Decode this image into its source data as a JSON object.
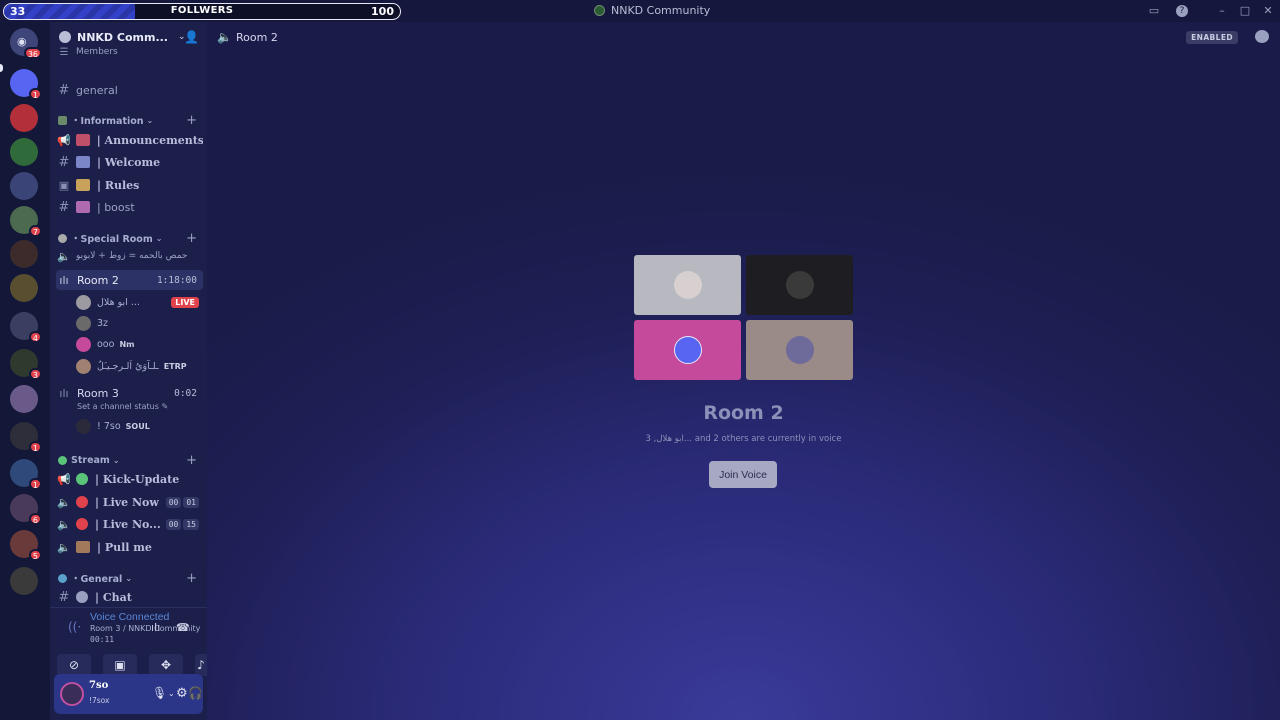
{
  "titlebar": {
    "followers_current": "33",
    "followers_label": "FOLLWERS",
    "followers_goal": "100",
    "followers_progress": 0.33,
    "app_title": "NNKD Community",
    "icons": [
      "inbox-icon",
      "help-icon",
      "minimize-icon",
      "maximize-icon",
      "close-icon"
    ]
  },
  "rail": {
    "home_badge": "36",
    "servers": [
      {
        "name": "discord-server",
        "badge": "1",
        "color": "#5865f2"
      },
      {
        "name": "red-server",
        "badge": "",
        "color": "#b3303a"
      },
      {
        "name": "nnkd-server",
        "badge": "",
        "color": "#2f6b3a"
      },
      {
        "name": "folder-server-1",
        "badge": "",
        "color": "#3b4476"
      },
      {
        "name": "folder-server-2",
        "badge": "7",
        "color": "#4c6a4f"
      },
      {
        "name": "dark-server",
        "badge": "",
        "color": "#3d2b2b"
      },
      {
        "name": "team-server",
        "badge": "",
        "color": "#5a4e30"
      },
      {
        "name": "folder-server-3",
        "badge": "4",
        "color": "#3a3f62"
      },
      {
        "name": "folder-server-4",
        "badge": "3",
        "color": "#2e3a2e"
      },
      {
        "name": "folder-server-5",
        "badge": "",
        "color": "#6a5a8a"
      },
      {
        "name": "folder-server-6",
        "badge": "1",
        "color": "#2e2e3a"
      },
      {
        "name": "folder-server-7",
        "badge": "1",
        "color": "#2f4a7a"
      },
      {
        "name": "folder-server-8",
        "badge": "6",
        "color": "#4a3a5a"
      },
      {
        "name": "folder-server-9",
        "badge": "5",
        "color": "#6a3a3a"
      },
      {
        "name": "folder-server-10",
        "badge": "",
        "color": "#3a3a3a"
      }
    ]
  },
  "sidebar": {
    "server_name": "NNKD Comm...",
    "members_label": "Members",
    "general": "general",
    "cat_information": "・Information",
    "announcements": "| Announcements",
    "welcome": "| Welcome",
    "rules": "| Rules",
    "boost": "| boost",
    "cat_special": "・Special Room",
    "arabic_room": "حمص بالحمه = زوط + لابوبو",
    "room2": "Room 2",
    "room2_timer": "1:18:00",
    "room2_users": [
      {
        "name": "ابو هلال ...",
        "tag": "",
        "live": "LIVE"
      },
      {
        "name": "3z",
        "tag": "",
        "live": ""
      },
      {
        "name": "ooo",
        "tag": "Nm",
        "live": ""
      },
      {
        "name": "ـلـآوَيُ اَلـرجـيـَلُ",
        "tag": "ETRP",
        "live": ""
      }
    ],
    "room3": "Room 3",
    "room3_timer": "0:02",
    "room3_status": "Set a channel status",
    "room3_users": [
      {
        "name": "! 7so",
        "tag": "SOUL"
      }
    ],
    "cat_stream": "Stream",
    "kick_update": "| Kick-Update",
    "live_now_1": "| Live Now",
    "live_now_1_nums": [
      "00",
      "01"
    ],
    "live_now_2": "| Live No...",
    "live_now_2_nums": [
      "00",
      "15"
    ],
    "pull_me": "| Pull me",
    "cat_general": "・General",
    "chat": "| Chat"
  },
  "voice": {
    "title": "Voice Connected",
    "sub": "Room 3 / NNKD Community",
    "time": "00:11"
  },
  "user": {
    "name": "7so",
    "sub": "!7sox"
  },
  "main": {
    "channel": "Room 2",
    "enabled_label": "ENABLED",
    "room_title": "Room 2",
    "room_sub": "ابو هلال, 3... and 2 others are currently in voice",
    "join_label": "Join Voice",
    "tiles": [
      {
        "name": "participant-tile-1",
        "bg": "#b8b8c0",
        "av": "#d8d0d0"
      },
      {
        "name": "participant-tile-2",
        "bg": "#1e1e22",
        "av": "#3a3a3a"
      },
      {
        "name": "participant-tile-3",
        "bg": "#c64a9c",
        "av": "#5865f2"
      },
      {
        "name": "participant-tile-4",
        "bg": "#9a8a88",
        "av": "#6e6a9a"
      }
    ]
  }
}
